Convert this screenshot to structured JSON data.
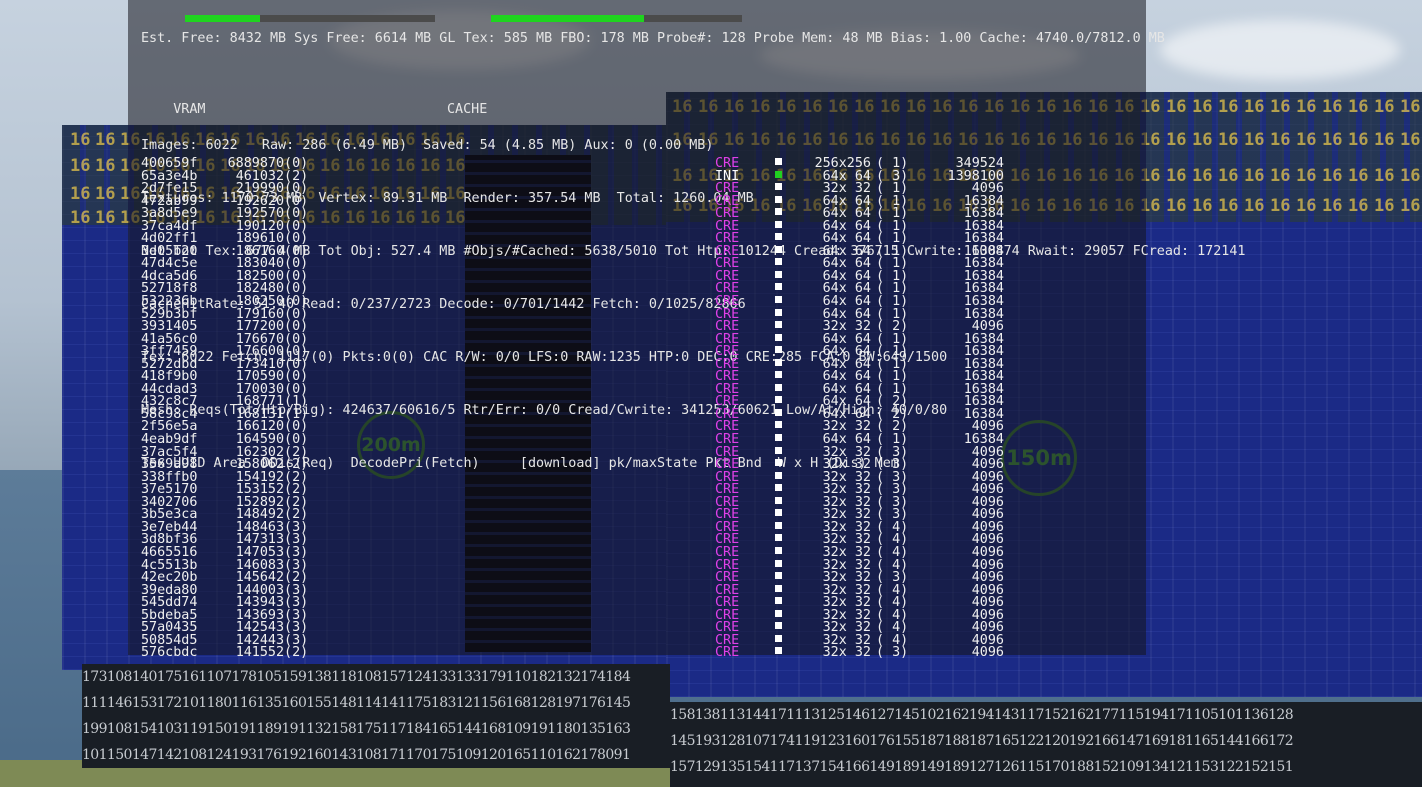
{
  "hud": {
    "line0": "Est. Free: 8432 MB Sys Free: 6614 MB GL Tex: 585 MB FBO: 178 MB Probe#: 128 Probe Mem: 48 MB Bias: 1.00 Cache: 4740.0/7812.0 MB",
    "vram_label": "VRAM",
    "vram_fill": 0.3,
    "cache_label": "CACHE",
    "cache_fill": 0.61,
    "images": "Images: 6022   Raw: 286 (6.49 MB)  Saved: 54 (4.85 MB) Aux: 0 (0.00 MB)",
    "textures": "Textures: 1170.73 MB  Vertex: 89.31 MB  Render: 357.54 MB  Total: 1260.04 MB",
    "net": "Net Tot Tex: 677.4 MB Tot Obj: 527.4 MB #Objs/#Cached: 5638/5010 Tot Htp: 101244 Cread: 376715 Cwrite: 100874 Rwait: 29057 FCread: 172141",
    "cache_hit": "CacheHitRate: 51.40 Read: 0/237/2723 Decode: 0/701/1442 Fetch: 0/1025/82866",
    "tex": "Tex: 6022 Fetch: 1117(0) Pkts:0(0) CAC R/W: 0/0 LFS:0 RAW:1235 HTP:0 DEC:0 CRE:285 FCA:0 BW:649/1500",
    "mesh": "Mesh: Reqs(Tot/Htp/Big): 424637/60616/5 Rtr/Err: 0/0 Cread/Cwrite: 341253/60621 Low/At/High: 40/0/80",
    "header": "Tex UUID Area  DDis(Req)  DecodePri(Fetch)     [download] pk/maxState Pkt Bnd  W x H (Dis) Mem"
  },
  "table": [
    {
      "uuid": "400659f",
      "area": "688987",
      "ddis": "0(0)",
      "state": "CRE",
      "wh": "256x256",
      "dis": "( 1)",
      "mem": "349524"
    },
    {
      "uuid": "65a3e4b",
      "area": "46103",
      "ddis": "2(2)",
      "state": "INI",
      "wh": "64x 64",
      "dis": "( 3)",
      "mem": "1398100"
    },
    {
      "uuid": "2d7fe15",
      "area": "21999",
      "ddis": "0(0)",
      "state": "CRE",
      "wh": "32x 32",
      "dis": "( 1)",
      "mem": "4096"
    },
    {
      "uuid": "472ab99",
      "area": "19262",
      "ddis": "0(0)",
      "state": "CRE",
      "wh": "64x 64",
      "dis": "( 1)",
      "mem": "16384"
    },
    {
      "uuid": "3a8d5e9",
      "area": "19257",
      "ddis": "0(0)",
      "state": "CRE",
      "wh": "64x 64",
      "dis": "( 1)",
      "mem": "16384"
    },
    {
      "uuid": "37ca4df",
      "area": "19012",
      "ddis": "0(0)",
      "state": "CRE",
      "wh": "64x 64",
      "dis": "( 1)",
      "mem": "16384"
    },
    {
      "uuid": "4d02ff1",
      "area": "18961",
      "ddis": "0(0)",
      "state": "CRE",
      "wh": "64x 64",
      "dis": "( 1)",
      "mem": "16384"
    },
    {
      "uuid": "3d05b20",
      "area": "18616",
      "ddis": "0(0)",
      "state": "CRE",
      "wh": "64x 64",
      "dis": "( 1)",
      "mem": "16384"
    },
    {
      "uuid": "47d4c5e",
      "area": "18304",
      "ddis": "0(0)",
      "state": "CRE",
      "wh": "64x 64",
      "dis": "( 1)",
      "mem": "16384"
    },
    {
      "uuid": "4dca5d6",
      "area": "18250",
      "ddis": "0(0)",
      "state": "CRE",
      "wh": "64x 64",
      "dis": "( 1)",
      "mem": "16384"
    },
    {
      "uuid": "52718f8",
      "area": "18248",
      "ddis": "0(0)",
      "state": "CRE",
      "wh": "64x 64",
      "dis": "( 1)",
      "mem": "16384"
    },
    {
      "uuid": "532236b",
      "area": "18025",
      "ddis": "0(0)",
      "state": "CRE",
      "wh": "64x 64",
      "dis": "( 1)",
      "mem": "16384"
    },
    {
      "uuid": "529b3bf",
      "area": "17916",
      "ddis": "0(0)",
      "state": "CRE",
      "wh": "64x 64",
      "dis": "( 1)",
      "mem": "16384"
    },
    {
      "uuid": "3931405",
      "area": "17720",
      "ddis": "0(0)",
      "state": "CRE",
      "wh": "32x 32",
      "dis": "( 2)",
      "mem": "4096"
    },
    {
      "uuid": "41a56c0",
      "area": "17667",
      "ddis": "0(0)",
      "state": "CRE",
      "wh": "64x 64",
      "dis": "( 1)",
      "mem": "16384"
    },
    {
      "uuid": "3ff7459",
      "area": "17660",
      "ddis": "0(0)",
      "state": "CRE",
      "wh": "64x 64",
      "dis": "( 1)",
      "mem": "16384"
    },
    {
      "uuid": "5272dbd",
      "area": "17341",
      "ddis": "0(0)",
      "state": "CRE",
      "wh": "64x 64",
      "dis": "( 1)",
      "mem": "16384"
    },
    {
      "uuid": "418f9b0",
      "area": "17059",
      "ddis": "0(0)",
      "state": "CRE",
      "wh": "64x 64",
      "dis": "( 1)",
      "mem": "16384"
    },
    {
      "uuid": "44cdad3",
      "area": "17003",
      "ddis": "0(0)",
      "state": "CRE",
      "wh": "64x 64",
      "dis": "( 1)",
      "mem": "16384"
    },
    {
      "uuid": "432c8c7",
      "area": "16877",
      "ddis": "1(1)",
      "state": "CRE",
      "wh": "64x 64",
      "dis": "( 2)",
      "mem": "16384"
    },
    {
      "uuid": "58c98c4",
      "area": "16813",
      "ddis": "1(1)",
      "state": "CRE",
      "wh": "64x 64",
      "dis": "( 2)",
      "mem": "16384"
    },
    {
      "uuid": "2f56e5a",
      "area": "16612",
      "ddis": "0(0)",
      "state": "CRE",
      "wh": "32x 32",
      "dis": "( 2)",
      "mem": "4096"
    },
    {
      "uuid": "4eab9df",
      "area": "16459",
      "ddis": "0(0)",
      "state": "CRE",
      "wh": "64x 64",
      "dis": "( 1)",
      "mem": "16384"
    },
    {
      "uuid": "37ac5f4",
      "area": "16230",
      "ddis": "2(2)",
      "state": "CRE",
      "wh": "32x 32",
      "dis": "( 3)",
      "mem": "4096"
    },
    {
      "uuid": "3569a98",
      "area": "15806",
      "ddis": "2(2)",
      "state": "CRE",
      "wh": "32x 32",
      "dis": "( 3)",
      "mem": "4096"
    },
    {
      "uuid": "338ffb0",
      "area": "15419",
      "ddis": "2(2)",
      "state": "CRE",
      "wh": "32x 32",
      "dis": "( 3)",
      "mem": "4096"
    },
    {
      "uuid": "37e5170",
      "area": "15315",
      "ddis": "2(2)",
      "state": "CRE",
      "wh": "32x 32",
      "dis": "( 3)",
      "mem": "4096"
    },
    {
      "uuid": "3402706",
      "area": "15289",
      "ddis": "2(2)",
      "state": "CRE",
      "wh": "32x 32",
      "dis": "( 3)",
      "mem": "4096"
    },
    {
      "uuid": "3b5e3ca",
      "area": "14849",
      "ddis": "2(2)",
      "state": "CRE",
      "wh": "32x 32",
      "dis": "( 3)",
      "mem": "4096"
    },
    {
      "uuid": "3e7eb44",
      "area": "14846",
      "ddis": "3(3)",
      "state": "CRE",
      "wh": "32x 32",
      "dis": "( 4)",
      "mem": "4096"
    },
    {
      "uuid": "3d8bf36",
      "area": "14731",
      "ddis": "3(3)",
      "state": "CRE",
      "wh": "32x 32",
      "dis": "( 4)",
      "mem": "4096"
    },
    {
      "uuid": "4665516",
      "area": "14705",
      "ddis": "3(3)",
      "state": "CRE",
      "wh": "32x 32",
      "dis": "( 4)",
      "mem": "4096"
    },
    {
      "uuid": "4c5513b",
      "area": "14608",
      "ddis": "3(3)",
      "state": "CRE",
      "wh": "32x 32",
      "dis": "( 4)",
      "mem": "4096"
    },
    {
      "uuid": "42ec20b",
      "area": "14564",
      "ddis": "2(2)",
      "state": "CRE",
      "wh": "32x 32",
      "dis": "( 3)",
      "mem": "4096"
    },
    {
      "uuid": "39eda80",
      "area": "14400",
      "ddis": "3(3)",
      "state": "CRE",
      "wh": "32x 32",
      "dis": "( 4)",
      "mem": "4096"
    },
    {
      "uuid": "545dd74",
      "area": "14394",
      "ddis": "3(3)",
      "state": "CRE",
      "wh": "32x 32",
      "dis": "( 4)",
      "mem": "4096"
    },
    {
      "uuid": "5bdeba5",
      "area": "14369",
      "ddis": "3(3)",
      "state": "CRE",
      "wh": "32x 32",
      "dis": "( 4)",
      "mem": "4096"
    },
    {
      "uuid": "57a0435",
      "area": "14254",
      "ddis": "3(3)",
      "state": "CRE",
      "wh": "32x 32",
      "dis": "( 4)",
      "mem": "4096"
    },
    {
      "uuid": "50854d5",
      "area": "14244",
      "ddis": "3(3)",
      "state": "CRE",
      "wh": "32x 32",
      "dis": "( 4)",
      "mem": "4096"
    },
    {
      "uuid": "576cbdc",
      "area": "14155",
      "ddis": "2(2)",
      "state": "CRE",
      "wh": "32x 32",
      "dis": "( 3)",
      "mem": "4096"
    }
  ],
  "scene": {
    "radar_left": "200m",
    "radar_right": "150m",
    "badge_text": "16",
    "num_left": [
      "173108140175161107178105159138118108157124133133179110182132174184",
      "111146153172101180116135160155148114141175183121156168128197176145",
      "199108154103119150191189191132158175117184165144168109191180135163",
      "101150147142108124193176192160143108171170175109120165110162178091"
    ],
    "num_right": [
      "158138113144171113125146127145102162194143117152162177115194171105101136128",
      "145193128107174119123160176155187188187165122120192166147169181165144166172",
      "157129135154117137154166149189149189127126115170188152109134121153122152151"
    ]
  },
  "colors": {
    "state_cre": "#e040e8",
    "state_ini": "#ffffff",
    "bar_fill": "#1fd41f"
  }
}
